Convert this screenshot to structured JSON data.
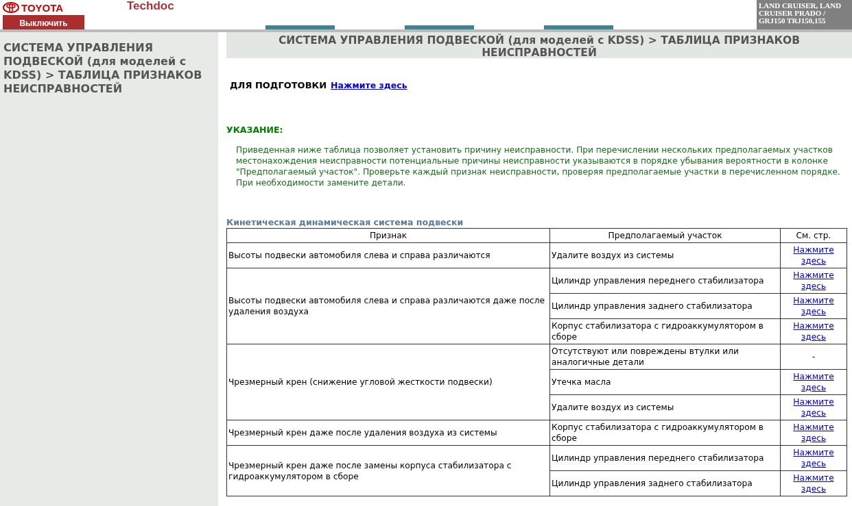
{
  "header": {
    "brand": "TOYOTA",
    "app_title": "Techdoc",
    "toggle_button": "Выключить",
    "vehicle": "LAND CRUISER, LAND CRUISER PRADO / GRJ150 TRJ150,155"
  },
  "sidebar": {
    "title": "СИСТЕМА УПРАВЛЕНИЯ ПОДВЕСКОЙ (для моделей с KDSS) > ТАБЛИЦА ПРИЗНАКОВ НЕИСПРАВНОСТЕЙ"
  },
  "page_title": "СИСТЕМА УПРАВЛЕНИЯ ПОДВЕСКОЙ (для моделей с KDSS) > ТАБЛИЦА ПРИЗНАКОВ НЕИСПРАВНОСТЕЙ",
  "prep": {
    "label": "ДЛЯ ПОДГОТОВКИ",
    "link": "Нажмите здесь"
  },
  "hint": {
    "heading": "УКАЗАНИЕ:",
    "text": "Приведенная ниже таблица позволяет установить причину неисправности. При перечислении нескольких предполагаемых участков местонахождения неисправности потенциальные причины неисправности указываются в порядке убывания вероятности в колонке \"Предполагаемый участок\". Проверьте каждый признак неисправности, проверяя предполагаемые участки в перечисленном порядке. При необходимости замените детали."
  },
  "table": {
    "caption": "Кинетическая динамическая система подвески",
    "columns": [
      "Признак",
      "Предполагаемый участок",
      "См. стр."
    ],
    "rows": [
      {
        "symptom": "Высоты подвески автомобиля слева и справа различаются",
        "parts": [
          {
            "part": "Удалите воздух из системы",
            "kind": "link",
            "ref": "Нажмите здесь"
          }
        ]
      },
      {
        "symptom": "Высоты подвески автомобиля слева и справа различаются даже после удаления воздуха",
        "parts": [
          {
            "part": "Цилиндр управления переднего стабилизатора",
            "kind": "link",
            "ref": "Нажмите здесь"
          },
          {
            "part": "Цилиндр управления заднего стабилизатора",
            "kind": "link",
            "ref": "Нажмите здесь"
          },
          {
            "part": "Корпус стабилизатора с гидроаккумулятором в сборе",
            "kind": "link",
            "ref": "Нажмите здесь"
          }
        ]
      },
      {
        "symptom": "Чрезмерный крен (снижение угловой жесткости подвески)",
        "parts": [
          {
            "part": "Отсутствуют или повреждены втулки или аналогичные детали",
            "kind": "text",
            "ref": "-"
          },
          {
            "part": "Утечка масла",
            "kind": "link",
            "ref": "Нажмите здесь"
          },
          {
            "part": "Удалите воздух из системы",
            "kind": "link",
            "ref": "Нажмите здесь"
          }
        ]
      },
      {
        "symptom": "Чрезмерный крен даже после удаления воздуха из системы",
        "parts": [
          {
            "part": "Корпус стабилизатора с гидроаккумулятором в сборе",
            "kind": "link",
            "ref": "Нажмите здесь"
          }
        ]
      },
      {
        "symptom": "Чрезмерный крен даже после замены корпуса стабилизатора с гидроаккумулятором в сборе",
        "parts": [
          {
            "part": "Цилиндр управления переднего стабилизатора",
            "kind": "link",
            "ref": "Нажмите здесь"
          },
          {
            "part": "Цилиндр управления заднего стабилизатора",
            "kind": "link",
            "ref": "Нажмите здесь"
          }
        ]
      }
    ]
  }
}
